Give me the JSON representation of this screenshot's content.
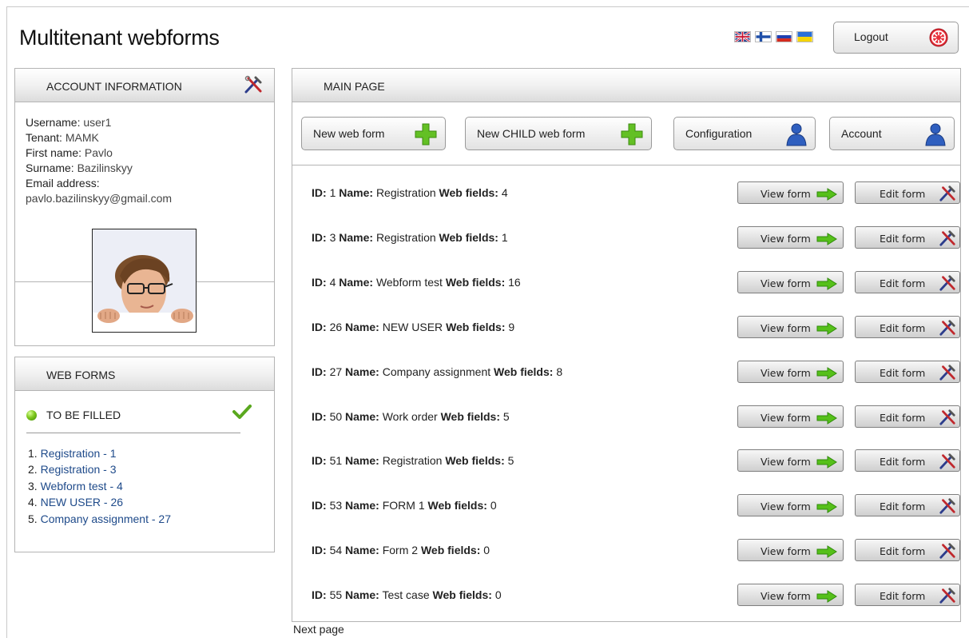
{
  "app": {
    "title": "Multitenant webforms"
  },
  "header": {
    "languages": [
      {
        "name": "english-flag-icon"
      },
      {
        "name": "finnish-flag-icon"
      },
      {
        "name": "russian-flag-icon"
      },
      {
        "name": "ukrainian-flag-icon"
      }
    ],
    "logout_label": "Logout"
  },
  "account": {
    "title": "ACCOUNT INFORMATION",
    "username_label": "Username:",
    "username": "user1",
    "tenant_label": "Tenant:",
    "tenant": "MAMK",
    "first_name_label": "First name:",
    "first_name": "Pavlo",
    "surname_label": "Surname:",
    "surname": "Bazilinskyy",
    "email_label": "Email address:",
    "email": "pavlo.bazilinskyy@gmail.com"
  },
  "web_forms": {
    "title": "WEB FORMS",
    "to_be_filled": "TO BE FILLED",
    "items": [
      {
        "num": "1.",
        "label": "Registration - 1"
      },
      {
        "num": "2.",
        "label": "Registration - 3"
      },
      {
        "num": "3.",
        "label": "Webform test - 4"
      },
      {
        "num": "4.",
        "label": "NEW USER - 26"
      },
      {
        "num": "5.",
        "label": "Company assignment - 27"
      }
    ]
  },
  "main": {
    "title": "MAIN PAGE",
    "toolbar": {
      "new_web_form": "New web form",
      "new_child_web_form": "New CHILD web form",
      "configuration": "Configuration",
      "account": "Account"
    },
    "labels": {
      "id": "ID:",
      "name": "Name:",
      "web_fields": "Web fields:"
    },
    "view_label": "View form",
    "edit_label": "Edit form",
    "forms": [
      {
        "id": "1",
        "name": "Registration",
        "fields": "4"
      },
      {
        "id": "3",
        "name": "Registration",
        "fields": "1"
      },
      {
        "id": "4",
        "name": "Webform test",
        "fields": "16"
      },
      {
        "id": "26",
        "name": "NEW USER",
        "fields": "9"
      },
      {
        "id": "27",
        "name": "Company assignment",
        "fields": "8"
      },
      {
        "id": "50",
        "name": "Work order",
        "fields": "5"
      },
      {
        "id": "51",
        "name": "Registration",
        "fields": "5"
      },
      {
        "id": "53",
        "name": "FORM 1",
        "fields": "0"
      },
      {
        "id": "54",
        "name": "Form 2",
        "fields": "0"
      },
      {
        "id": "55",
        "name": "Test case",
        "fields": "0"
      }
    ],
    "next_page": "Next page"
  },
  "colors": {
    "link": "#1e4a8a",
    "accent_green": "#5fbe1e",
    "panel_border": "#b4b4b4"
  }
}
